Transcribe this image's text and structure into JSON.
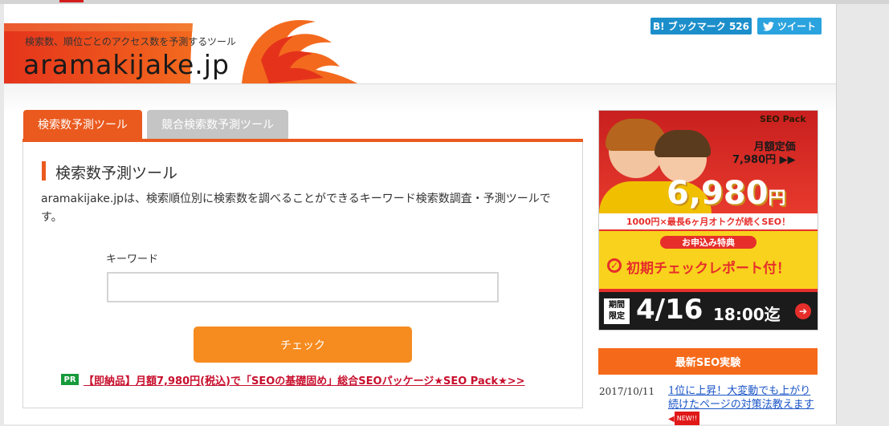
{
  "header": {
    "tagline": "検索数、順位ごとのアクセス数を予測するツール",
    "logo_text": "aramakijake.jp",
    "bookmark_button": "B! ブックマーク 526",
    "tweet_button": "ツイート"
  },
  "tabs": [
    {
      "label": "検索数予測ツール",
      "active": true
    },
    {
      "label": "競合検索数予測ツール",
      "active": false
    }
  ],
  "main": {
    "section_title": "検索数予測ツール",
    "description": "aramakijake.jpは、検索順位別に検索数を調べることができるキーワード検索数調査・予測ツールです。",
    "keyword_label": "キーワード",
    "keyword_value": "",
    "check_button": "チェック",
    "pr_badge": "PR",
    "pr_link": "【即納品】月額7,980円(税込)で「SEOの基礎固め」総合SEOパッケージ★SEO Pack★>>"
  },
  "ad": {
    "brand": "SEO Pack",
    "regular_label": "月額定価",
    "regular_price": "7,980円 ▶▶",
    "sale_price": "6,980",
    "sale_unit": "円",
    "offer": "1000円×最長6ヶ月オトクが続くSEO！",
    "special_label": "お申込み特典",
    "special_text": "初期チェックレポート付！",
    "limit_line1": "期間",
    "limit_line2": "限定",
    "deadline_date": "4/16",
    "deadline_time": "18:00迄"
  },
  "sidebar": {
    "heading": "最新SEO実験",
    "news": [
      {
        "date": "2017/10/11",
        "title": "1位に上昇！大変動でも上がり続けたページの対策法教えます",
        "badge": "NEW!!"
      }
    ]
  },
  "colors": {
    "accent": "#ea5a1e",
    "button": "#f68b1f",
    "link": "#1a55c7",
    "pr_link": "#c8102e",
    "bookmark": "#1c8fcb",
    "tweet": "#2aa3de"
  }
}
